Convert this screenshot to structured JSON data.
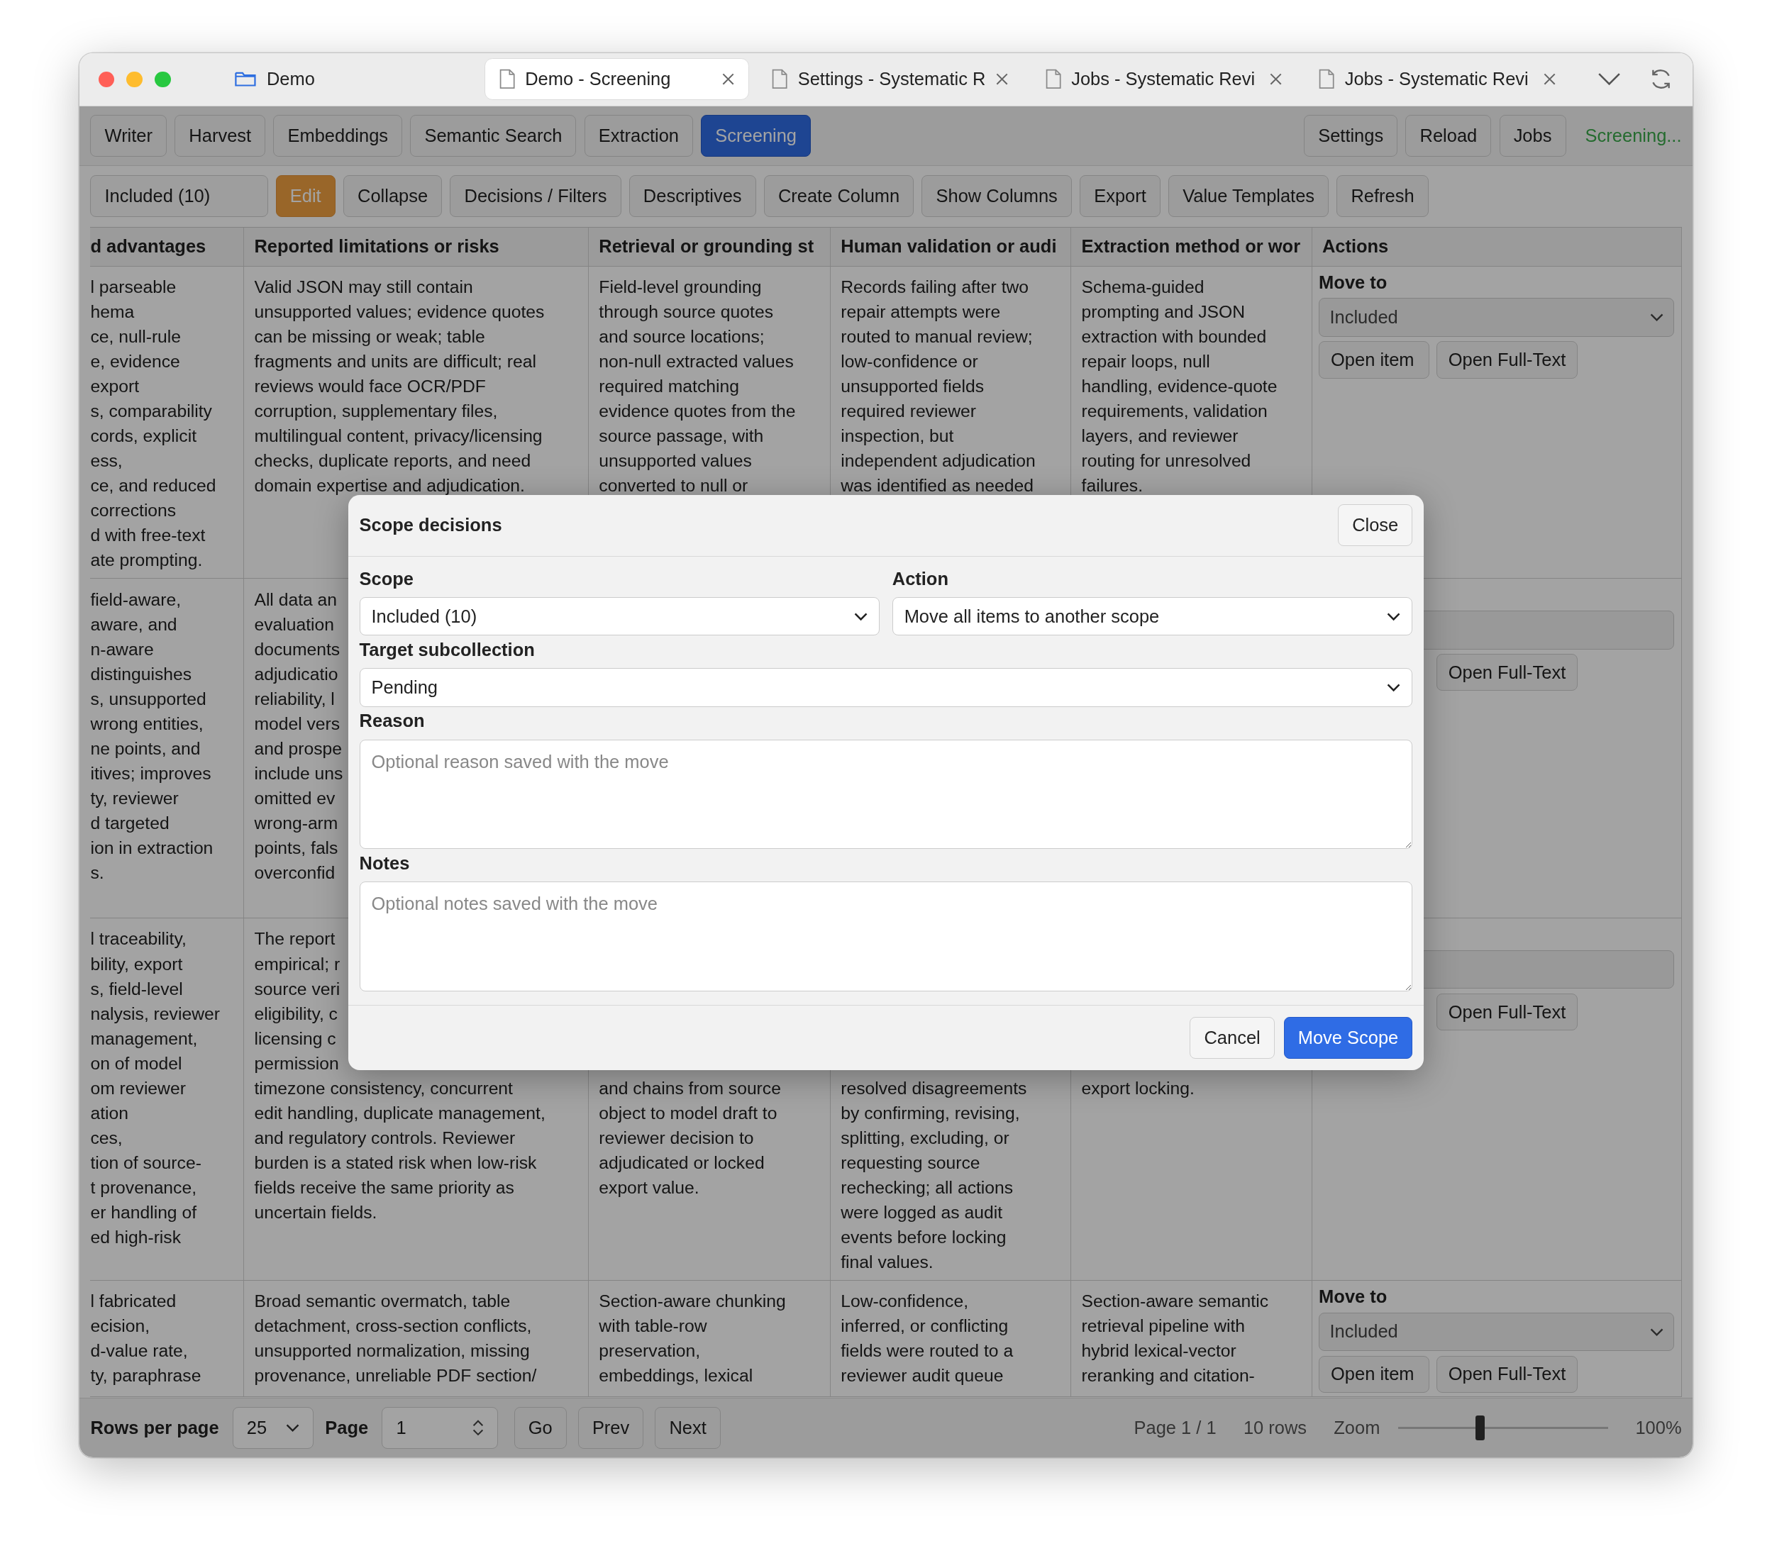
{
  "browser_tabs": [
    {
      "label": "Demo",
      "kind": "folder",
      "selected": false
    },
    {
      "label": "Demo - Screening",
      "kind": "page",
      "selected": true
    },
    {
      "label": "Settings - Systematic R",
      "kind": "page",
      "selected": false
    },
    {
      "label": "Jobs - Systematic Revi",
      "kind": "page",
      "selected": false
    },
    {
      "label": "Jobs - Systematic Revi",
      "kind": "page",
      "selected": false
    }
  ],
  "nav_tabs": [
    {
      "label": "Writer",
      "selected": false
    },
    {
      "label": "Harvest",
      "selected": false
    },
    {
      "label": "Embeddings",
      "selected": false
    },
    {
      "label": "Semantic Search",
      "selected": false
    },
    {
      "label": "Extraction",
      "selected": false
    },
    {
      "label": "Screening",
      "selected": true
    }
  ],
  "nav_buttons": [
    "Settings",
    "Reload",
    "Jobs"
  ],
  "status": "Screening...",
  "toolbar": {
    "scope": "Included (10)",
    "buttons": [
      {
        "label": "Edit",
        "kind": "accent"
      },
      {
        "label": "Collapse",
        "kind": "plain"
      },
      {
        "label": "Decisions / Filters",
        "kind": "plain"
      },
      {
        "label": "Descriptives",
        "kind": "plain"
      },
      {
        "label": "Create Column",
        "kind": "plain"
      },
      {
        "label": "Show Columns",
        "kind": "plain"
      },
      {
        "label": "Export",
        "kind": "plain"
      },
      {
        "label": "Value Templates",
        "kind": "plain"
      },
      {
        "label": "Refresh",
        "kind": "plain"
      }
    ]
  },
  "table": {
    "columns": [
      "d advantages",
      "Reported limitations or risks",
      "Retrieval or grounding st",
      "Human validation or audi",
      "Extraction method or wor",
      "Actions"
    ],
    "rows": [
      {
        "cells": [
          {
            "above": "l parseable\nhema\nce, null-rule\ne, evidence\nexport\ns, comparability\ncords, explicit\ness,\nce, and reduced\ncorrections\nd with free-text\nate prompting."
          },
          {
            "above": "Valid JSON may still contain\nunsupported values; evidence quotes\ncan be missing or weak; table\nfragments and units are difficult; real\nreviews would face OCR/PDF\ncorruption, supplementary files,\nmultilingual content, privacy/licensing\nchecks, duplicate reports, and need\ndomain expertise and adjudication."
          },
          {
            "above": "Field-level grounding\nthrough source quotes\nand source locations;\nnon-null extracted values\nrequired matching\nevidence quotes from the\nsource passage, with\nunsupported values\nconverted to null or"
          },
          {
            "above": "Records failing after two\nrepair attempts were\nrouted to manual review;\nlow-confidence or\nunsupported fields\nrequired reviewer\ninspection, but\nindependent adjudication\nwas identified as needed"
          },
          {
            "above": "Schema-guided\nprompting and JSON\nextraction with bounded\nrepair loops, null\nhandling, evidence-quote\nrequirements, validation\nlayers, and reviewer\nrouting for unresolved\nfailures."
          }
        ],
        "actions": {
          "label": "Move to",
          "select": {
            "value": "Included"
          },
          "buttons": [
            {
              "label": "Open item",
              "kind": "item"
            },
            {
              "label": "Open Full-Text",
              "kind": "fulltext"
            }
          ]
        }
      },
      {
        "cells": [
          {
            "above": "field-aware,\naware, and\nn-aware\ndistinguishes\ns, unsupported\nwrong entities,\nne points, and\nitives; improves\nty, reviewer\nd targeted\nion in extraction\ns."
          },
          {
            "above": "All data an\nevaluation\ndocuments\nadjudicatio\nreliability, l\nmodel vers\nand prospe\ninclude uns\nomitted ev\nwrong-arm\npoints, fals\noverconfid"
          },
          {},
          {},
          {}
        ],
        "actions": {
          "buttons": [
            {
              "label": "Open Full-Text",
              "kind": "fulltext"
            }
          ]
        }
      },
      {
        "cells": [
          {
            "above": "l traceability,\nbility, export\ns, field-level\nnalysis, reviewer\nmanagement,\non of model\nom reviewer\nation\nces,\ntion of source-\nt provenance,\ner handling of\ned high-risk"
          },
          {
            "above": "The report\nempirical; r\nsource veri\neligibility, c\nlicensing c\npermission",
            "below": "timezone consistency, concurrent\nedit handling, duplicate management,\nand regulatory controls. Reviewer\nburden is a stated risk when low-risk\nfields receive the same priority as\nuncertain fields."
          },
          {
            "below": "and chains from source\nobject to model draft to\nreviewer decision to\nadjudicated or locked\nexport value."
          },
          {
            "below": "resolved disagreements\nby confirming, revising,\nsplitting, excluding, or\nrequesting source\nrechecking; all actions\nwere logged as audit\nevents before locking\nfinal values."
          },
          {
            "below": "export locking."
          }
        ],
        "actions": {
          "buttons": [
            {
              "label": "Open Full-Text",
              "kind": "fulltext"
            }
          ]
        }
      },
      {
        "cells": [
          {
            "above": "l fabricated\necision,\nd-value rate,\nty, paraphrase"
          },
          {
            "above": "Broad semantic overmatch, table\ndetachment, cross-section conflicts,\nunsupported normalization, missing\nprovenance, unreliable PDF section/"
          },
          {
            "above": "Section-aware chunking\nwith table-row\npreservation,\nembeddings, lexical"
          },
          {
            "above": "Low-confidence,\ninferred, or conflicting\nfields were routed to a\nreviewer audit queue"
          },
          {
            "above": "Section-aware semantic\nretrieval pipeline with\nhybrid lexical-vector\nreranking and citation-"
          }
        ],
        "actions": {
          "label": "Move to",
          "select": {
            "value": "Included"
          },
          "buttons": [
            {
              "label": "Open item",
              "kind": "item"
            },
            {
              "label": "Open Full-Text",
              "kind": "fulltext"
            }
          ]
        }
      }
    ]
  },
  "footer": {
    "rows_per_page": {
      "label": "Rows per page",
      "value": "25"
    },
    "page": {
      "label": "Page",
      "value": "1"
    },
    "buttons": [
      "Go",
      "Prev",
      "Next"
    ],
    "page_info": "Page 1 / 1",
    "row_count": "10 rows",
    "zoom": {
      "label": "Zoom",
      "level": 0.37,
      "reading": "100%"
    }
  },
  "dialog": {
    "title": "Scope decisions",
    "close": "Close",
    "fields": [
      {
        "label": "Scope",
        "kind": "select",
        "value": "Included (10)"
      },
      {
        "label": "Action",
        "kind": "select",
        "value": "Move all items to another scope"
      },
      {
        "label": "Target subcollection",
        "kind": "select",
        "value": "Pending"
      },
      {
        "label": "Reason",
        "kind": "textarea",
        "placeholder": "Optional reason saved with the move"
      },
      {
        "label": "Notes",
        "kind": "textarea",
        "placeholder": "Optional notes saved with the move"
      }
    ],
    "buttons": [
      {
        "label": "Cancel",
        "kind": "secondary"
      },
      {
        "label": "Move Scope",
        "kind": "primary"
      }
    ]
  }
}
